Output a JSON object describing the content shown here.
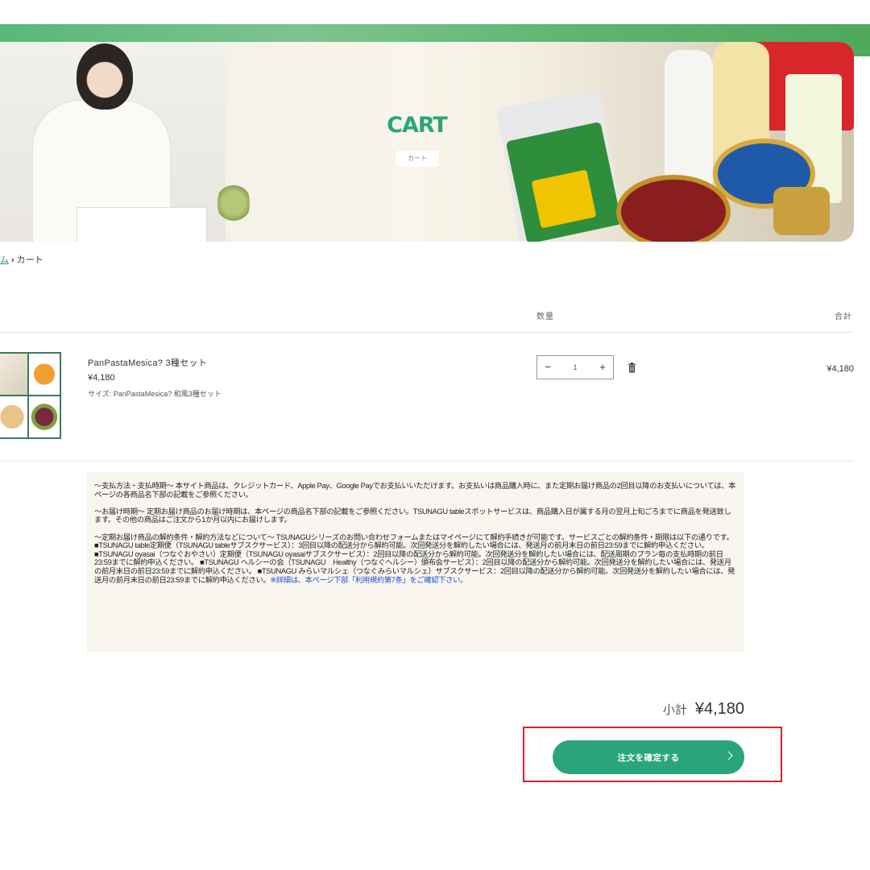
{
  "hero": {
    "title": "CART",
    "subtitle": "カート"
  },
  "breadcrumb": {
    "home": "ム",
    "separator": "›",
    "current": "カート"
  },
  "table": {
    "qty_header": "数量",
    "total_header": "合計"
  },
  "item": {
    "name": "PanPastaMesica? 3種セット",
    "price": "¥4,180",
    "size": "サイズ: PanPastaMesica? 和風3種セット",
    "quantity": "1",
    "minus": "−",
    "plus": "+",
    "line_total": "¥4,180"
  },
  "notice": {
    "p1": "〜支払方法・支払時期〜 本サイト商品は、クレジットカード、Apple Pay、Google Payでお支払いいただけます。お支払いは商品購入時に、また定期お届け商品の2回目以降のお支払いについては、本ページの各商品名下部の記載をご参照ください。",
    "p2": "〜お届け時期〜 定期お届け商品のお届け時期は、本ページの商品名下部の記載をご参照ください。TSUNAGU tableスポットサービスは、商品購入日が属する月の翌月上旬ごろまでに商品を発送致します。その他の商品はご注文から1か月以内にお届けします。",
    "p3": "〜定期お届け商品の解約条件・解約方法などについて〜 TSUNAGUシリーズのお問い合わせフォームまたはマイページにて解約手続きが可能です。サービスごとの解約条件・期限は以下の通りです。 ■TSUNAGU table定期便（TSUNAGU tableサブスクサービス）：3回目以降の配送分から解約可能。次回発送分を解約したい場合には、発送月の前月末日の前日23:59までに解約申込ください。 ■TSUNAGU oyasai（つなぐおやさい）定期便（TSUNAGU oyasaiサブスクサービス）：2回目以降の配送分から解約可能。次回発送分を解約したい場合には、配送周期のプラン毎の支払時期の前日23:59までに解約申込ください。 ■TSUNAGU ヘルシーの会（TSUNAGU　Healthy（つなぐヘルシー）頒布会サービス）：2回目以降の配送分から解約可能。次回発送分を解約したい場合には、発送月の前月末日の前日23:59までに解約申込ください。 ■TSUNAGU みらいマルシェ（つなぐみらいマルシェ）サブスクサービス：2回目以降の配送分から解約可能。次回発送分を解約したい場合には、発送月の前月末日の前日23:59までに解約申込ください。",
    "link": "※詳細は、本ページ下部「利用規約第7条」をご確認下さい。"
  },
  "summary": {
    "subtotal_label": "小計",
    "subtotal_value": "¥4,180",
    "checkout_label": "注文を確定する"
  },
  "colors": {
    "accent": "#2aa57b",
    "highlight_frame": "#e0202a",
    "notice_bg": "#f8f6ee"
  }
}
